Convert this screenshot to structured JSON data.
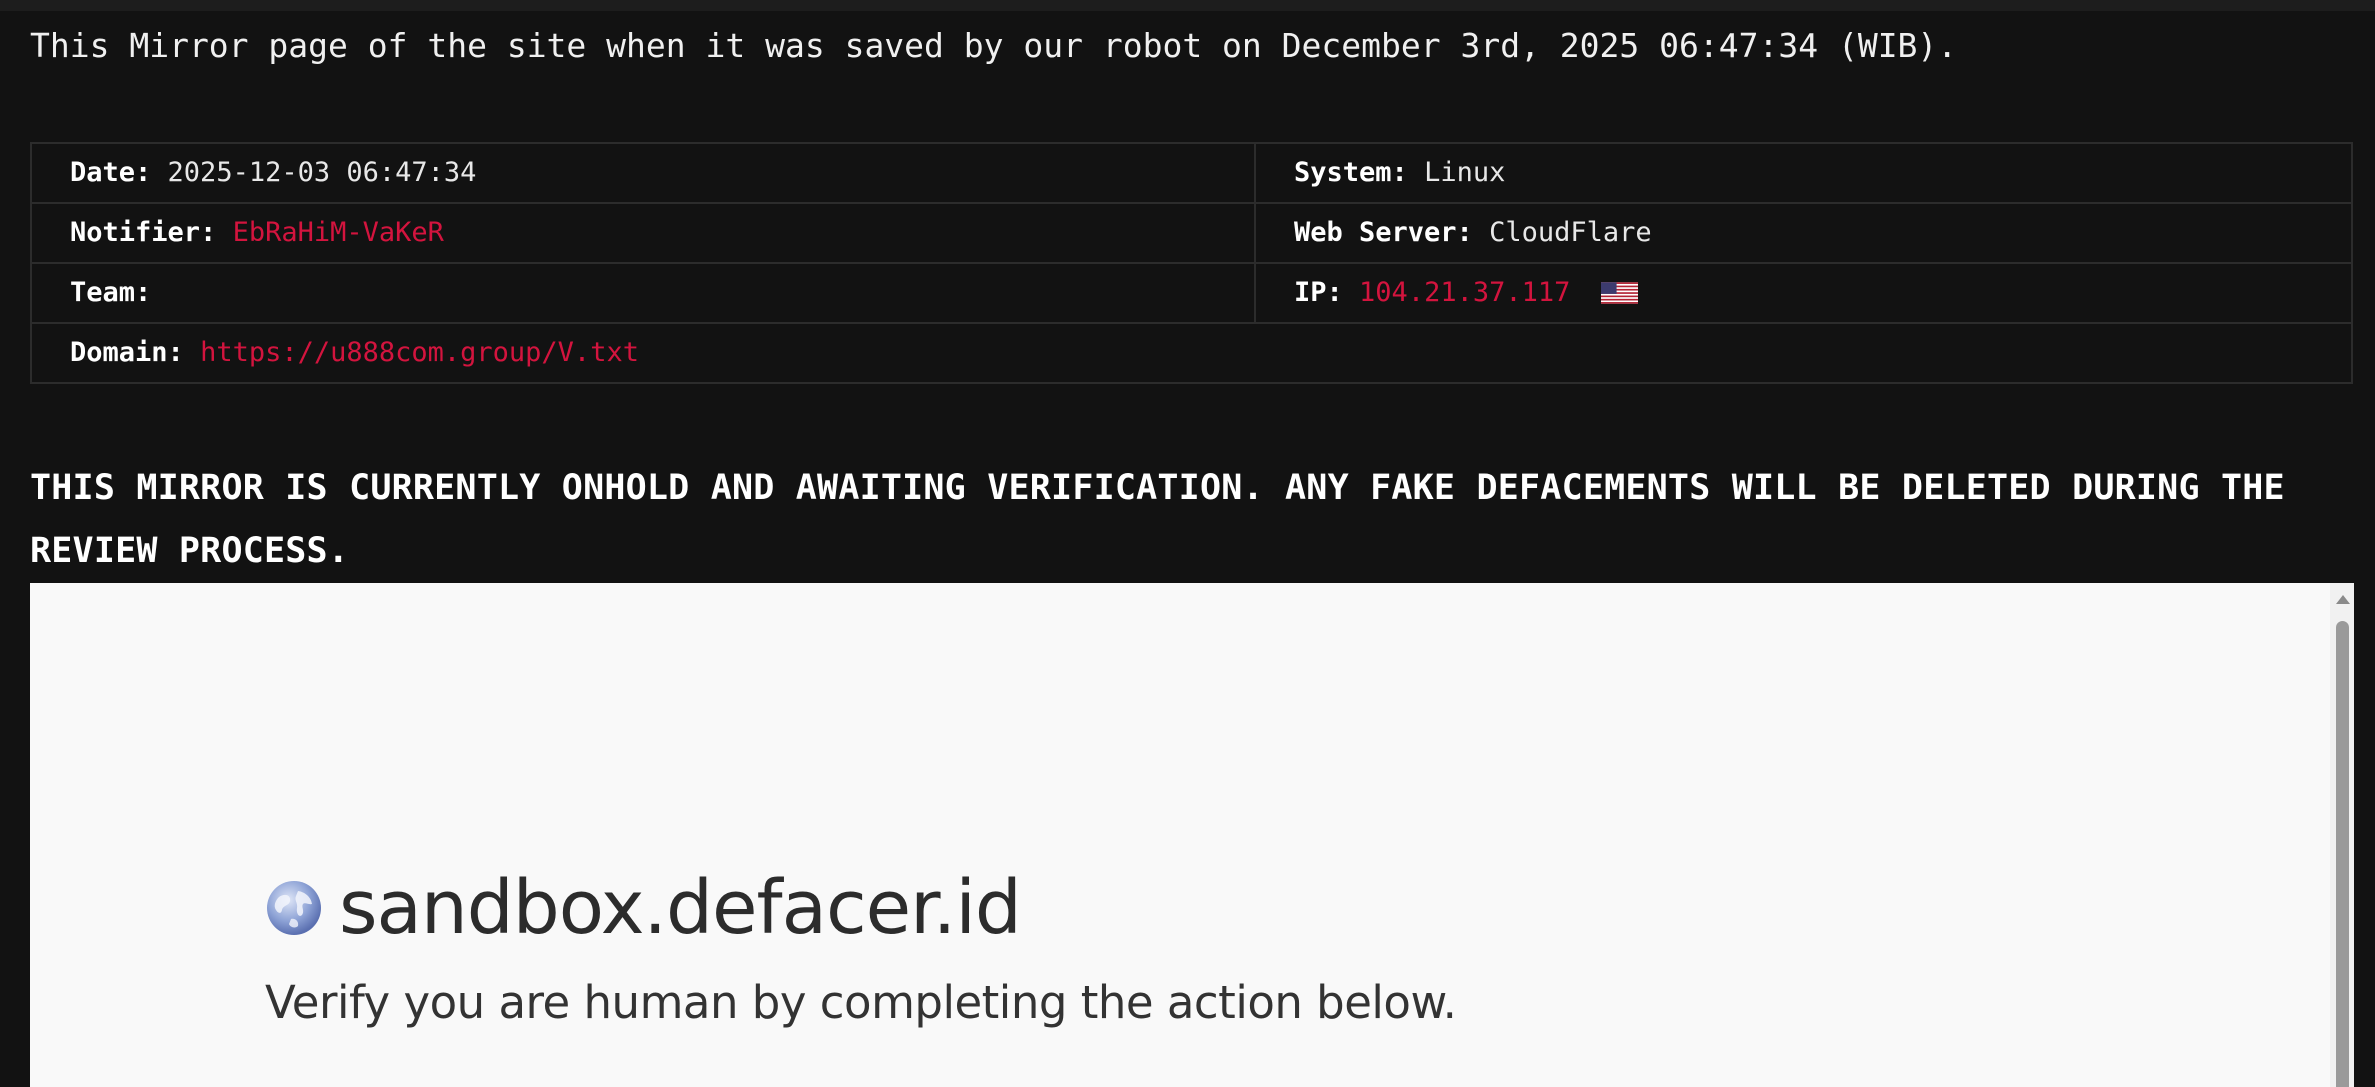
{
  "notice": "This Mirror page of the site when it was saved by our robot on December 3rd, 2025 06:47:34 (WIB).",
  "info": {
    "date": {
      "label": "Date:",
      "value": "2025-12-03 06:47:34"
    },
    "system": {
      "label": "System:",
      "value": "Linux"
    },
    "notifier": {
      "label": "Notifier:",
      "value": "EbRaHiM-VaKeR"
    },
    "web_server": {
      "label": "Web Server:",
      "value": "CloudFlare"
    },
    "team": {
      "label": "Team:",
      "value": ""
    },
    "ip": {
      "label": "IP:",
      "value": "104.21.37.117",
      "flag": "us-flag-icon"
    },
    "domain": {
      "label": "Domain:",
      "value": "https://u888com.group/V.txt"
    }
  },
  "warning": "THIS MIRROR IS CURRENTLY ONHOLD AND AWAITING VERIFICATION. ANY FAKE DEFACEMENTS WILL BE DELETED DURING THE REVIEW PROCESS.",
  "mirror": {
    "site_name": "sandbox.defacer.id",
    "verify_text": "Verify you are human by completing the action below.",
    "icon": "globe-icon"
  },
  "colors": {
    "background": "#121212",
    "accent_red": "#d3143e",
    "frame_background": "#f9f9f9"
  }
}
